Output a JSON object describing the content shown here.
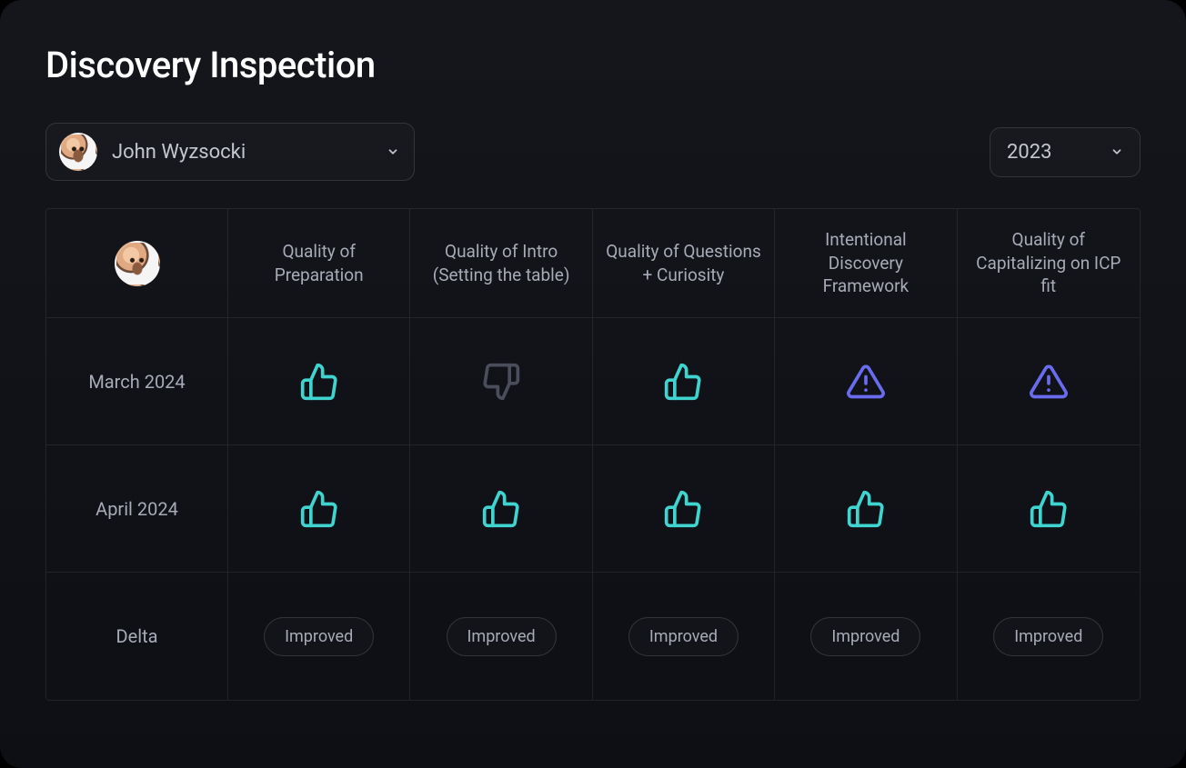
{
  "title": "Discovery Inspection",
  "person_selector": {
    "name": "John Wyzsocki"
  },
  "year_selector": {
    "value": "2023"
  },
  "columns": [
    "Quality of Preparation",
    "Quality of Intro (Setting the table)",
    "Quality of Questions + Curiosity",
    "Intentional Discovery Framework",
    "Quality of Capitalizing on ICP fit"
  ],
  "rows": [
    {
      "label": "March 2024",
      "cells": [
        "thumbs-up",
        "thumbs-down",
        "thumbs-up",
        "warning",
        "warning"
      ]
    },
    {
      "label": "April 2024",
      "cells": [
        "thumbs-up",
        "thumbs-up",
        "thumbs-up",
        "thumbs-up",
        "thumbs-up"
      ]
    }
  ],
  "delta": {
    "label": "Delta",
    "cells": [
      "Improved",
      "Improved",
      "Improved",
      "Improved",
      "Improved"
    ]
  },
  "colors": {
    "thumbs_up": "#3FD4CF",
    "thumbs_down": "#4A4E5A",
    "warning": "#6A6CF0"
  }
}
